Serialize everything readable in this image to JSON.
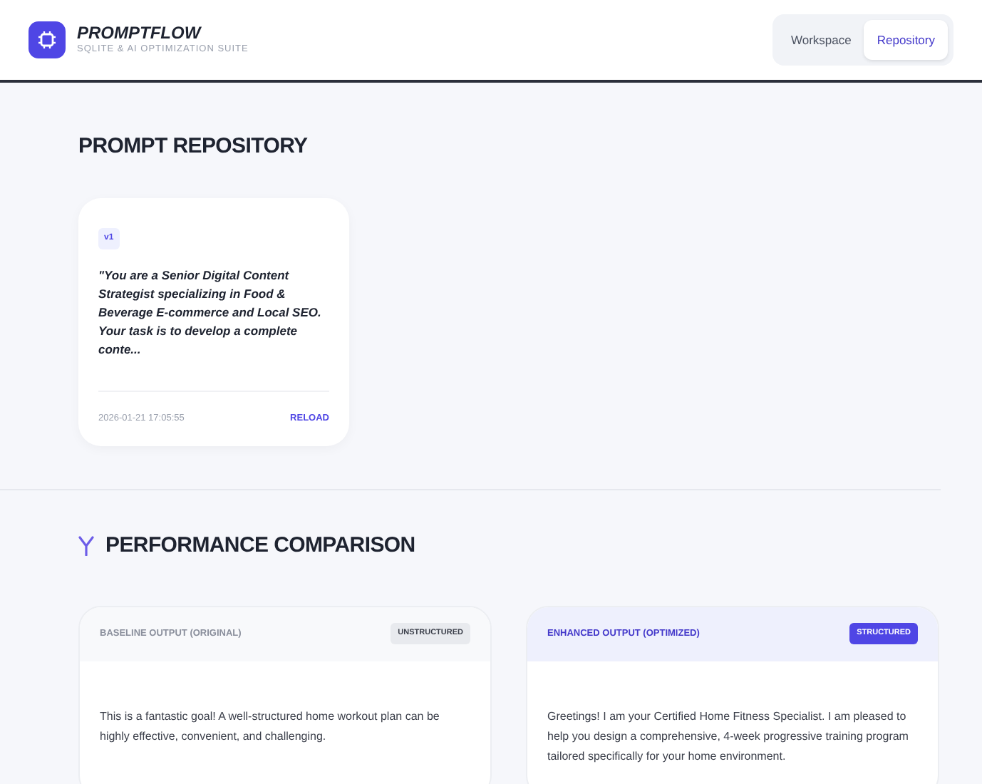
{
  "brand": {
    "name": "PROMPTFLOW",
    "subtitle": "SQLITE & AI OPTIMIZATION SUITE"
  },
  "nav": [
    {
      "label": "Workspace",
      "selected": false
    },
    {
      "label": "Repository",
      "selected": true
    }
  ],
  "repository": {
    "title": "PROMPT REPOSITORY",
    "prompts": [
      {
        "version": "v1",
        "text": "\"You are a Senior Digital Content Strategist specializing in Food & Beverage E-commerce and Local SEO. Your task is to develop a complete conte...",
        "timestamp": "2026-01-21 17:05:55",
        "action": "RELOAD"
      }
    ]
  },
  "comparison": {
    "title": "PERFORMANCE COMPARISON",
    "panels": [
      {
        "kind": "baseline",
        "title": "BASELINE OUTPUT (ORIGINAL)",
        "badge": "UNSTRUCTURED",
        "text": "This is a fantastic goal! A well-structured home workout plan can be highly effective, convenient, and challenging."
      },
      {
        "kind": "enhanced",
        "title": "ENHANCED OUTPUT (OPTIMIZED)",
        "badge": "STRUCTURED",
        "text": "Greetings! I am your Certified Home Fitness Specialist. I am pleased to help you design a comprehensive, 4-week progressive training program tailored specifically for your home environment."
      }
    ]
  }
}
